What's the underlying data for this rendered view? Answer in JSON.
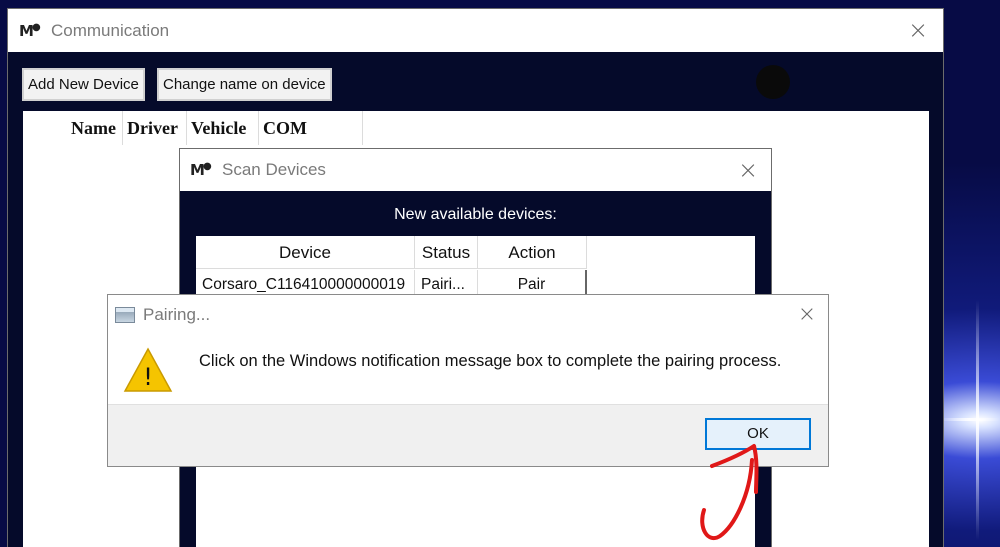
{
  "main_window": {
    "logo": "M",
    "title": "Communication",
    "toolbar": {
      "add_label": "Add New Device",
      "rename_label": "Change name on device"
    },
    "columns": [
      "Name",
      "Driver",
      "Vehicle",
      "COM"
    ]
  },
  "scan_window": {
    "logo": "M",
    "title": "Scan Devices",
    "subtitle": "New available devices:",
    "columns": [
      "Device",
      "Status",
      "Action"
    ],
    "rows": [
      {
        "device": "Corsaro_C116410000000019",
        "status": "Pairi...",
        "action": "Pair"
      }
    ]
  },
  "pairing_dialog": {
    "title": "Pairing...",
    "message": "Click on the Windows notification message box to complete the pairing process.",
    "ok_label": "OK",
    "warning_icon": "!"
  },
  "icons": {
    "close": "×",
    "warning": "warning-icon",
    "window": "window-icon"
  },
  "colors": {
    "dark_bg": "#050a2a",
    "ok_border": "#0078d7",
    "warning_yellow": "#f5c400",
    "annotation_red": "#e01818"
  }
}
